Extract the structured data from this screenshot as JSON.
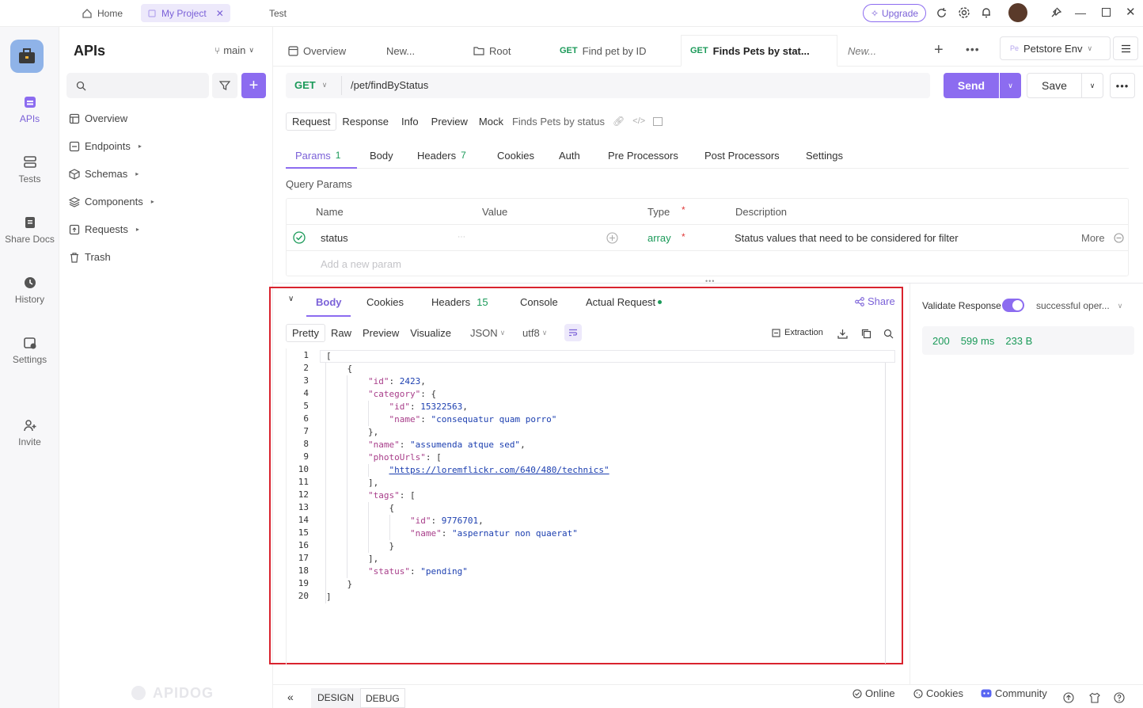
{
  "window": {
    "tabs": [
      "Home",
      "My Project",
      "Test"
    ],
    "upgrade_label": "Upgrade"
  },
  "rail": {
    "items": [
      "APIs",
      "Tests",
      "Share Docs",
      "History",
      "Settings",
      "Invite"
    ]
  },
  "sidebar": {
    "title": "APIs",
    "branch": "main",
    "search_placeholder": "",
    "items": [
      "Overview",
      "Endpoints",
      "Schemas",
      "Components",
      "Requests",
      "Trash"
    ],
    "watermark": "APIDOG"
  },
  "tabs": {
    "items": [
      {
        "method": "",
        "label": "Overview"
      },
      {
        "method": "",
        "label": "New..."
      },
      {
        "method": "",
        "label": "Root"
      },
      {
        "method": "GET",
        "label": "Find pet by ID"
      },
      {
        "method": "GET",
        "label": "Finds Pets by stat..."
      },
      {
        "method": "",
        "label": "New..."
      }
    ],
    "env": "Petstore Env",
    "env_badge": "Pe"
  },
  "request": {
    "method": "GET",
    "url": "/pet/findByStatus",
    "send_label": "Send",
    "save_label": "Save",
    "mode_tabs": [
      "Request",
      "Response",
      "Info",
      "Preview",
      "Mock"
    ],
    "name": "Finds Pets by status",
    "subtabs": [
      {
        "label": "Params",
        "count": "1"
      },
      {
        "label": "Body",
        "count": ""
      },
      {
        "label": "Headers",
        "count": "7"
      },
      {
        "label": "Cookies",
        "count": ""
      },
      {
        "label": "Auth",
        "count": ""
      },
      {
        "label": "Pre Processors",
        "count": ""
      },
      {
        "label": "Post Processors",
        "count": ""
      },
      {
        "label": "Settings",
        "count": ""
      }
    ],
    "section_title": "Query Params",
    "table": {
      "columns": [
        "Name",
        "Value",
        "Type",
        "Description"
      ],
      "row": {
        "name": "status",
        "value": "",
        "type": "array",
        "required": "*",
        "description": "Status values that need to be considered for filter",
        "more": "More"
      },
      "add_placeholder": "Add a new param"
    }
  },
  "response": {
    "tabs": [
      {
        "label": "Body",
        "count": ""
      },
      {
        "label": "Cookies",
        "count": ""
      },
      {
        "label": "Headers",
        "count": "15"
      },
      {
        "label": "Console",
        "count": ""
      },
      {
        "label": "Actual Request",
        "count": ""
      }
    ],
    "share_label": "Share",
    "view_modes": [
      "Pretty",
      "Raw",
      "Preview",
      "Visualize"
    ],
    "format": "JSON",
    "encoding": "utf8",
    "extraction_label": "Extraction",
    "validate_label": "Validate Response",
    "validate_on": true,
    "validate_target": "successful oper...",
    "status_code": "200",
    "time": "599 ms",
    "size": "233 B",
    "body_lines": [
      "[",
      "    {",
      "        \"id\": 2423,",
      "        \"category\": {",
      "            \"id\": 15322563,",
      "            \"name\": \"consequatur quam porro\"",
      "        },",
      "        \"name\": \"assumenda atque sed\",",
      "        \"photoUrls\": [",
      "            \"https://loremflickr.com/640/480/technics\"",
      "        ],",
      "        \"tags\": [",
      "            {",
      "                \"id\": 9776701,",
      "                \"name\": \"aspernatur non quaerat\"",
      "            }",
      "        ],",
      "        \"status\": \"pending\"",
      "    }",
      "]"
    ]
  },
  "footer": {
    "design_label": "DESIGN",
    "debug_label": "DEBUG",
    "online_label": "Online",
    "cookies_label": "Cookies",
    "community_label": "Community"
  },
  "colors": {
    "accent": "#8c6cf0",
    "get_green": "#1b9a59",
    "highlight_red": "#d9232e"
  }
}
